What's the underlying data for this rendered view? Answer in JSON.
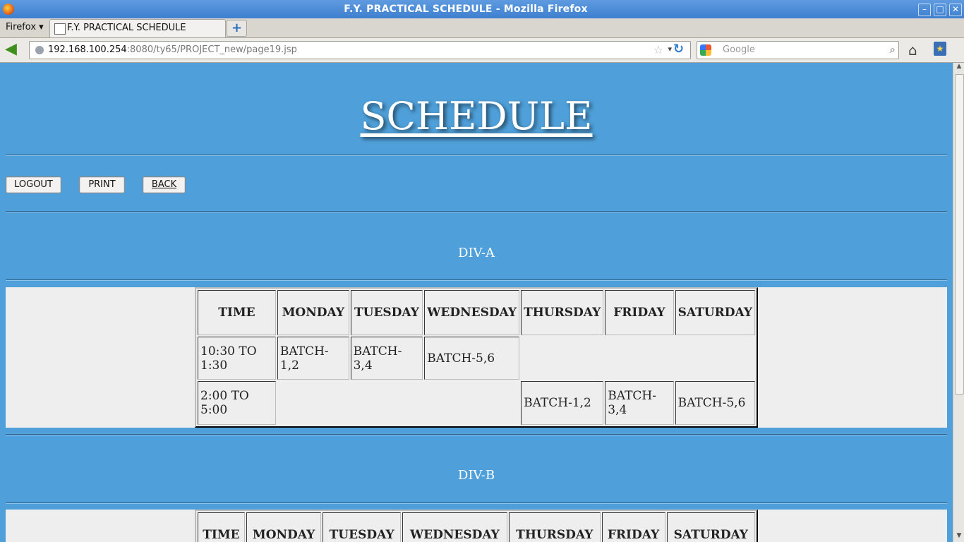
{
  "browser": {
    "window_title": "F.Y. PRACTICAL SCHEDULE - Mozilla Firefox",
    "menu_label": "Firefox",
    "tab_title": "F.Y. PRACTICAL SCHEDULE",
    "url_host": "192.168.100.254",
    "url_rest": ":8080/ty65/PROJECT_new/page19.jsp",
    "search_placeholder": "Google"
  },
  "page": {
    "title": "SCHEDULE",
    "buttons": {
      "logout": "LOGOUT",
      "print": "PRINT",
      "back": "BACK"
    },
    "sections": [
      {
        "label": "DIV-A",
        "headers": [
          "TIME",
          "MONDAY",
          "TUESDAY",
          "WEDNESDAY",
          "THURSDAY",
          "FRIDAY",
          "SATURDAY"
        ],
        "rows": [
          [
            "10:30 TO 1:30",
            "BATCH-1,2",
            "BATCH-3,4",
            "BATCH-5,6",
            "",
            "",
            ""
          ],
          [
            "2:00 TO 5:00",
            "",
            "",
            "",
            "BATCH-1,2",
            "BATCH-3,4",
            "BATCH-5,6"
          ]
        ]
      },
      {
        "label": "DIV-B",
        "headers": [
          "TIME",
          "MONDAY",
          "TUESDAY",
          "WEDNESDAY",
          "THURSDAY",
          "FRIDAY",
          "SATURDAY"
        ]
      }
    ]
  }
}
